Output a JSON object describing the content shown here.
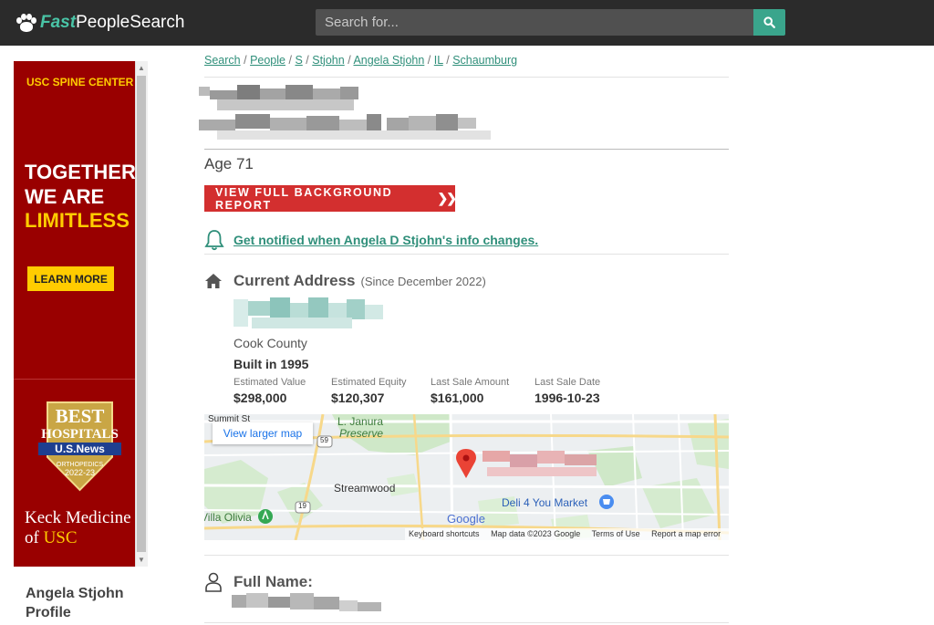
{
  "header": {
    "logo_fast": "Fast",
    "logo_rest": "PeopleSearch",
    "search_placeholder": "Search for..."
  },
  "ad": {
    "brand": "USC SPINE CENTER",
    "line1": "TOGETHER",
    "line2": "WE ARE",
    "line3": "LIMITLESS",
    "button": "LEARN MORE",
    "badge_best": "BEST",
    "badge_hospitals": "HOSPITALS",
    "badge_usnews": "U.S.News",
    "badge_orthopedics": "ORTHOPEDICS",
    "badge_years": "2022-23",
    "keck_line1": "Keck Medicine",
    "keck_of": "of",
    "keck_usc": "USC"
  },
  "side": {
    "profile_line1": "Angela Stjohn",
    "profile_line2": "Profile"
  },
  "breadcrumb": [
    "Search",
    "People",
    "S",
    "Stjohn",
    "Angela Stjohn",
    "IL",
    "Schaumburg"
  ],
  "person": {
    "age": "Age 71",
    "cta": "VIEW FULL BACKGROUND REPORT",
    "notify": "Get notified when Angela D Stjohn's info changes."
  },
  "address": {
    "title": "Current Address",
    "since": "(Since December 2022)",
    "county": "Cook County",
    "built": "Built in 1995",
    "stats": [
      {
        "label": "Estimated Value",
        "value": "$298,000"
      },
      {
        "label": "Estimated Equity",
        "value": "$120,307"
      },
      {
        "label": "Last Sale Amount",
        "value": "$161,000"
      },
      {
        "label": "Last Sale Date",
        "value": "1996-10-23"
      }
    ]
  },
  "map": {
    "view_larger": "View larger map",
    "labels": {
      "summit": "Summit St",
      "janura": "L. Janura",
      "preserve": "Preserve",
      "route59": "59",
      "route19": "19",
      "streamwood": "Streamwood",
      "villa_olivia": "Villa Olivia",
      "deli": "Deli 4 You Market",
      "google": "Google"
    },
    "footer": [
      "Keyboard shortcuts",
      "Map data ©2023 Google",
      "Terms of Use",
      "Report a map error"
    ]
  },
  "fullname": {
    "title": "Full Name:"
  },
  "colors": {
    "accent": "#2f8f7a",
    "cta": "#d32f2f",
    "topbar": "#2b2b2b",
    "ad_red": "#990000"
  }
}
